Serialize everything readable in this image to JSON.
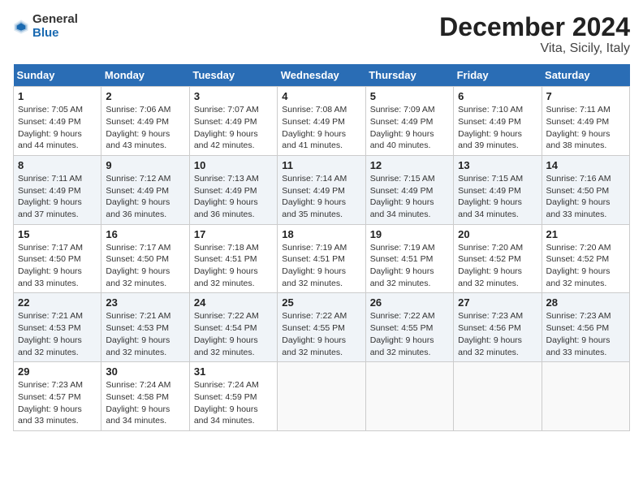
{
  "logo": {
    "general": "General",
    "blue": "Blue"
  },
  "header": {
    "month": "December 2024",
    "location": "Vita, Sicily, Italy"
  },
  "weekdays": [
    "Sunday",
    "Monday",
    "Tuesday",
    "Wednesday",
    "Thursday",
    "Friday",
    "Saturday"
  ],
  "weeks": [
    [
      {
        "day": "1",
        "info": "Sunrise: 7:05 AM\nSunset: 4:49 PM\nDaylight: 9 hours\nand 44 minutes."
      },
      {
        "day": "2",
        "info": "Sunrise: 7:06 AM\nSunset: 4:49 PM\nDaylight: 9 hours\nand 43 minutes."
      },
      {
        "day": "3",
        "info": "Sunrise: 7:07 AM\nSunset: 4:49 PM\nDaylight: 9 hours\nand 42 minutes."
      },
      {
        "day": "4",
        "info": "Sunrise: 7:08 AM\nSunset: 4:49 PM\nDaylight: 9 hours\nand 41 minutes."
      },
      {
        "day": "5",
        "info": "Sunrise: 7:09 AM\nSunset: 4:49 PM\nDaylight: 9 hours\nand 40 minutes."
      },
      {
        "day": "6",
        "info": "Sunrise: 7:10 AM\nSunset: 4:49 PM\nDaylight: 9 hours\nand 39 minutes."
      },
      {
        "day": "7",
        "info": "Sunrise: 7:11 AM\nSunset: 4:49 PM\nDaylight: 9 hours\nand 38 minutes."
      }
    ],
    [
      {
        "day": "8",
        "info": "Sunrise: 7:11 AM\nSunset: 4:49 PM\nDaylight: 9 hours\nand 37 minutes."
      },
      {
        "day": "9",
        "info": "Sunrise: 7:12 AM\nSunset: 4:49 PM\nDaylight: 9 hours\nand 36 minutes."
      },
      {
        "day": "10",
        "info": "Sunrise: 7:13 AM\nSunset: 4:49 PM\nDaylight: 9 hours\nand 36 minutes."
      },
      {
        "day": "11",
        "info": "Sunrise: 7:14 AM\nSunset: 4:49 PM\nDaylight: 9 hours\nand 35 minutes."
      },
      {
        "day": "12",
        "info": "Sunrise: 7:15 AM\nSunset: 4:49 PM\nDaylight: 9 hours\nand 34 minutes."
      },
      {
        "day": "13",
        "info": "Sunrise: 7:15 AM\nSunset: 4:49 PM\nDaylight: 9 hours\nand 34 minutes."
      },
      {
        "day": "14",
        "info": "Sunrise: 7:16 AM\nSunset: 4:50 PM\nDaylight: 9 hours\nand 33 minutes."
      }
    ],
    [
      {
        "day": "15",
        "info": "Sunrise: 7:17 AM\nSunset: 4:50 PM\nDaylight: 9 hours\nand 33 minutes."
      },
      {
        "day": "16",
        "info": "Sunrise: 7:17 AM\nSunset: 4:50 PM\nDaylight: 9 hours\nand 32 minutes."
      },
      {
        "day": "17",
        "info": "Sunrise: 7:18 AM\nSunset: 4:51 PM\nDaylight: 9 hours\nand 32 minutes."
      },
      {
        "day": "18",
        "info": "Sunrise: 7:19 AM\nSunset: 4:51 PM\nDaylight: 9 hours\nand 32 minutes."
      },
      {
        "day": "19",
        "info": "Sunrise: 7:19 AM\nSunset: 4:51 PM\nDaylight: 9 hours\nand 32 minutes."
      },
      {
        "day": "20",
        "info": "Sunrise: 7:20 AM\nSunset: 4:52 PM\nDaylight: 9 hours\nand 32 minutes."
      },
      {
        "day": "21",
        "info": "Sunrise: 7:20 AM\nSunset: 4:52 PM\nDaylight: 9 hours\nand 32 minutes."
      }
    ],
    [
      {
        "day": "22",
        "info": "Sunrise: 7:21 AM\nSunset: 4:53 PM\nDaylight: 9 hours\nand 32 minutes."
      },
      {
        "day": "23",
        "info": "Sunrise: 7:21 AM\nSunset: 4:53 PM\nDaylight: 9 hours\nand 32 minutes."
      },
      {
        "day": "24",
        "info": "Sunrise: 7:22 AM\nSunset: 4:54 PM\nDaylight: 9 hours\nand 32 minutes."
      },
      {
        "day": "25",
        "info": "Sunrise: 7:22 AM\nSunset: 4:55 PM\nDaylight: 9 hours\nand 32 minutes."
      },
      {
        "day": "26",
        "info": "Sunrise: 7:22 AM\nSunset: 4:55 PM\nDaylight: 9 hours\nand 32 minutes."
      },
      {
        "day": "27",
        "info": "Sunrise: 7:23 AM\nSunset: 4:56 PM\nDaylight: 9 hours\nand 32 minutes."
      },
      {
        "day": "28",
        "info": "Sunrise: 7:23 AM\nSunset: 4:56 PM\nDaylight: 9 hours\nand 33 minutes."
      }
    ],
    [
      {
        "day": "29",
        "info": "Sunrise: 7:23 AM\nSunset: 4:57 PM\nDaylight: 9 hours\nand 33 minutes."
      },
      {
        "day": "30",
        "info": "Sunrise: 7:24 AM\nSunset: 4:58 PM\nDaylight: 9 hours\nand 34 minutes."
      },
      {
        "day": "31",
        "info": "Sunrise: 7:24 AM\nSunset: 4:59 PM\nDaylight: 9 hours\nand 34 minutes."
      },
      null,
      null,
      null,
      null
    ]
  ]
}
